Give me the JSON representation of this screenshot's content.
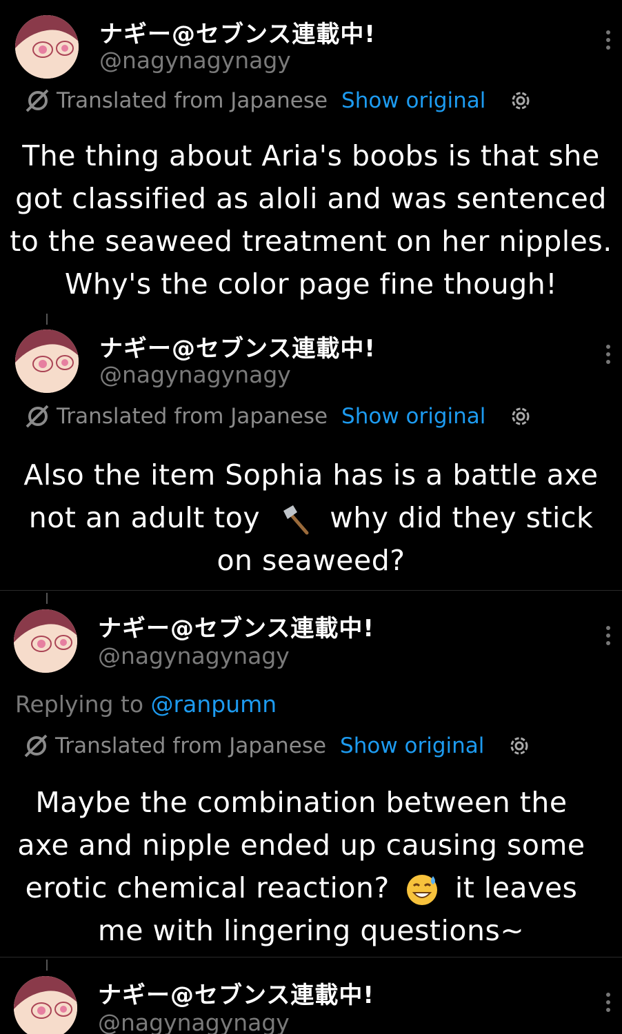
{
  "posts": [
    {
      "display_name": "ナギー@セブンス連載中!",
      "handle": "@nagynagynagy",
      "translated_label": "Translated from Japanese",
      "show_original": "Show original",
      "text_lines": [
        "The thing about Aria's boobs is that she",
        "got classified as aloli and was sentenced",
        "to the seaweed treatment on her nipples.",
        "Why's the color page fine though!"
      ]
    },
    {
      "display_name": "ナギー@セブンス連載中!",
      "handle": "@nagynagynagy",
      "translated_label": "Translated from Japanese",
      "show_original": "Show original",
      "text_lines": [
        "Also the item Sophia has is a battle axe",
        "not an adult toy",
        "why did they stick",
        "on seaweed?"
      ]
    },
    {
      "display_name": "ナギー@セブンス連載中!",
      "handle": "@nagynagynagy",
      "replying_prefix": "Replying to",
      "replying_to": "@ranpumn",
      "translated_label": "Translated from Japanese",
      "show_original": "Show original",
      "text_lines": [
        "Maybe the combination between the",
        "axe and nipple ended up causing some",
        "erotic chemical reaction?",
        "it leaves",
        "me with lingering questions~"
      ]
    },
    {
      "display_name": "ナギー@セブンス連載中!",
      "handle": "@nagynagynagy"
    }
  ],
  "icons": {
    "translate": "translate-icon",
    "settings": "gear-icon",
    "more": "more-vertical-icon",
    "axe": "axe-emoji-icon",
    "sweat_smile": "sweat-smile-emoji-icon"
  },
  "colors": {
    "background": "#000000",
    "link": "#1d9bf0",
    "secondary_text": "#7a7a7a"
  }
}
